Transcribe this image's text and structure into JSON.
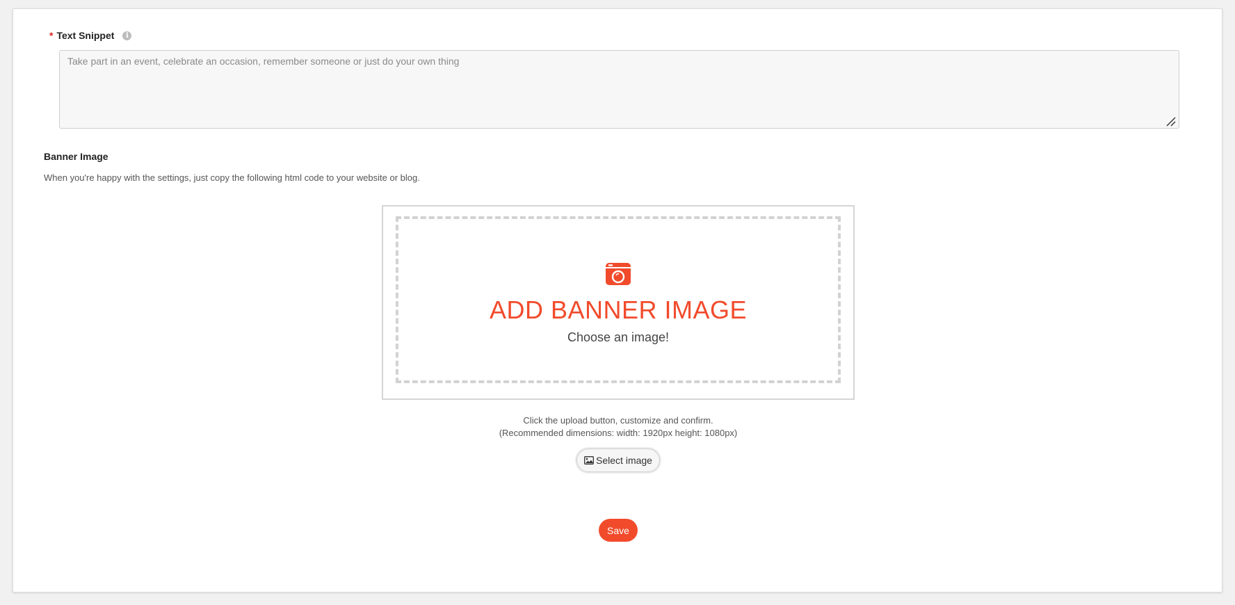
{
  "text_snippet": {
    "required_mark": "*",
    "label": "Text Snippet",
    "info_icon": "info-icon",
    "value": "",
    "placeholder": "Take part in an event, celebrate an occasion, remember someone or just do your own thing"
  },
  "banner": {
    "title": "Banner Image",
    "description": "When you're happy with the settings, just copy the following html code to your website or blog.",
    "icon": "camera-icon",
    "heading": "ADD BANNER IMAGE",
    "subheading": "Choose an image!",
    "hint_line1": "Click the upload button, customize and confirm.",
    "hint_line2": "(Recommended dimensions: width: 1920px height: 1080px)",
    "select_label": "Select image",
    "select_icon": "image-icon"
  },
  "actions": {
    "save_label": "Save"
  },
  "colors": {
    "accent": "#f14b2c",
    "required": "#e02020"
  }
}
